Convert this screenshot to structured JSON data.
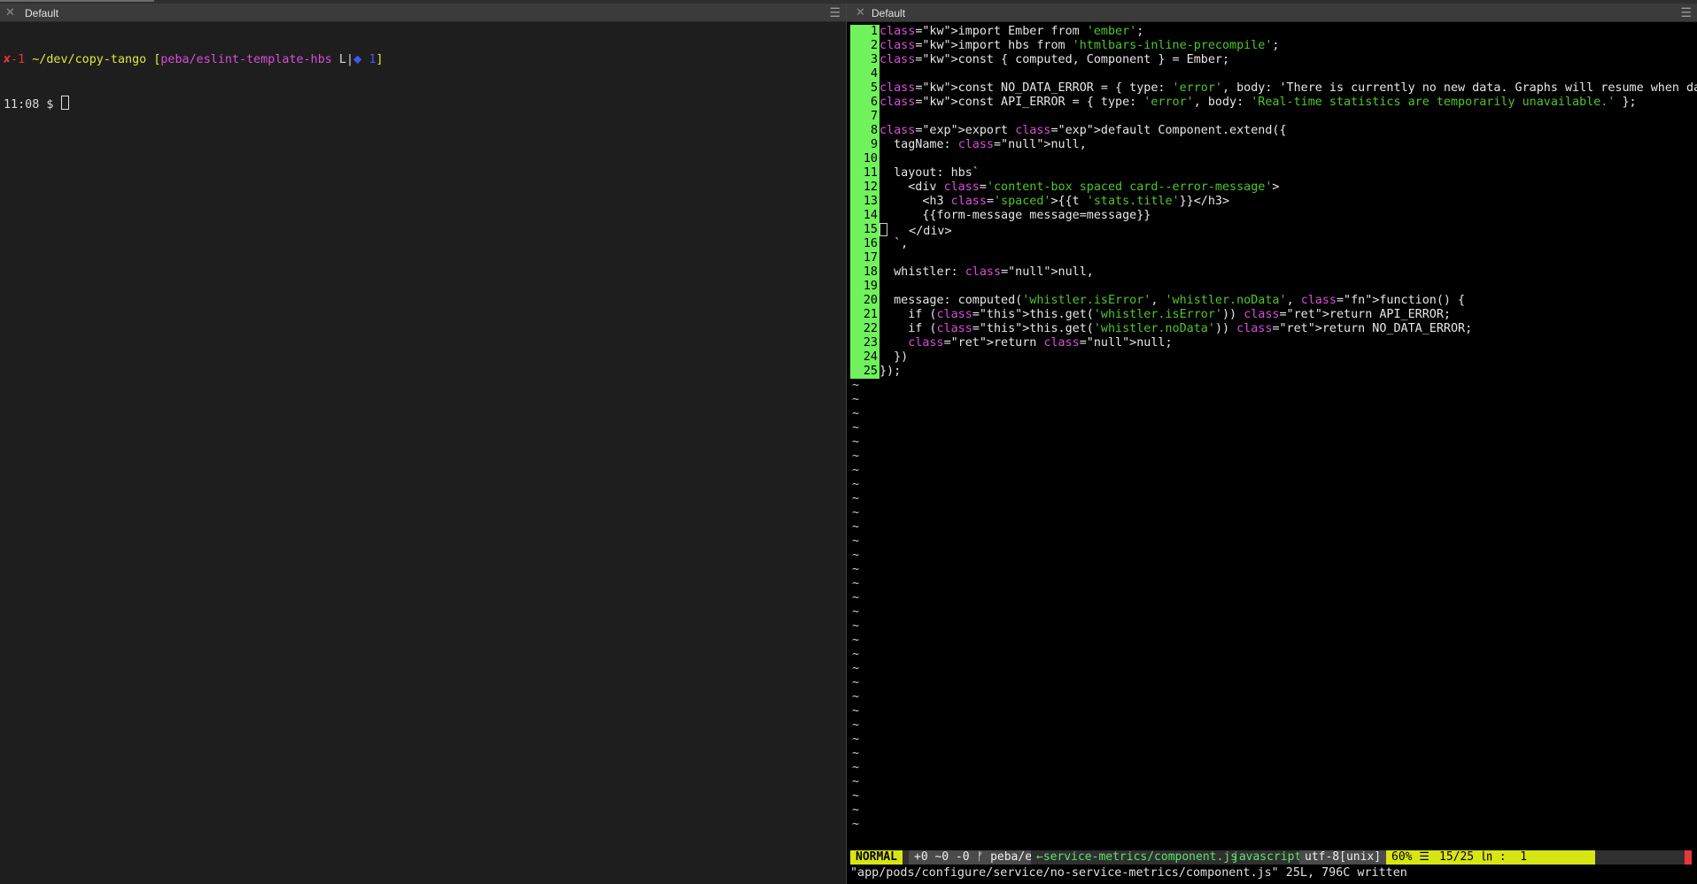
{
  "panes": {
    "left_title": "Default",
    "right_title": "Default"
  },
  "shell": {
    "status_marker": "✘-1",
    "path": "~/dev/copy-tango",
    "branch": "peba/eslint-template-hbs",
    "branch_flag": "L",
    "branch_icon": "⬥",
    "branch_count": "1",
    "time": "11:08",
    "prompt": "$"
  },
  "vim": {
    "lines": [
      "import Ember from 'ember';",
      "import hbs from 'htmlbars-inline-precompile';",
      "const { computed, Component } = Ember;",
      "",
      "const NO_DATA_ERROR = { type: 'error', body: 'There is currently no new data. Graphs will resume when data is rece",
      "const API_ERROR = { type: 'error', body: 'Real-time statistics are temporarily unavailable.' };",
      "",
      "export default Component.extend({",
      "  tagName: null,",
      "",
      "  layout: hbs`",
      "    <div class='content-box spaced card--error-message'>",
      "      <h3 class='spaced'>{{t 'stats.title'}}</h3>",
      "      {{form-message message=message}}",
      "    </div>",
      "  `,",
      "",
      "  whistler: null,",
      "",
      "  message: computed('whistler.isError', 'whistler.noData', function() {",
      "    if (this.get('whistler.isError')) return API_ERROR;",
      "    if (this.get('whistler.noData')) return NO_DATA_ERROR;",
      "    return null;",
      "  })",
      "});"
    ],
    "line_numbers": [
      "1",
      "2",
      "3",
      "4",
      "5",
      "6",
      "7",
      "8",
      "9",
      "10",
      "11",
      "12",
      "13",
      "14",
      "15",
      "16",
      "17",
      "18",
      "19",
      "20",
      "21",
      "22",
      "23",
      "24",
      "25"
    ],
    "tilde": "~",
    "statusline": {
      "mode": "NORMAL",
      "git": "+0 ~0 -0 ᚠ peba/es…",
      "file": "←service-metrics/component.js",
      "filetype": "javascript",
      "encoding": "utf-8[unix]",
      "percent": "60% ☰",
      "position": "15/25 ㏑ :  1"
    },
    "message": "\"app/pods/configure/service/no-service-metrics/component.js\" 25L, 796C written"
  },
  "colors": {
    "gutter": "#6ff25c",
    "mode": "#d8e514",
    "string": "#4fc62a",
    "keyword": "#d84fd8"
  }
}
